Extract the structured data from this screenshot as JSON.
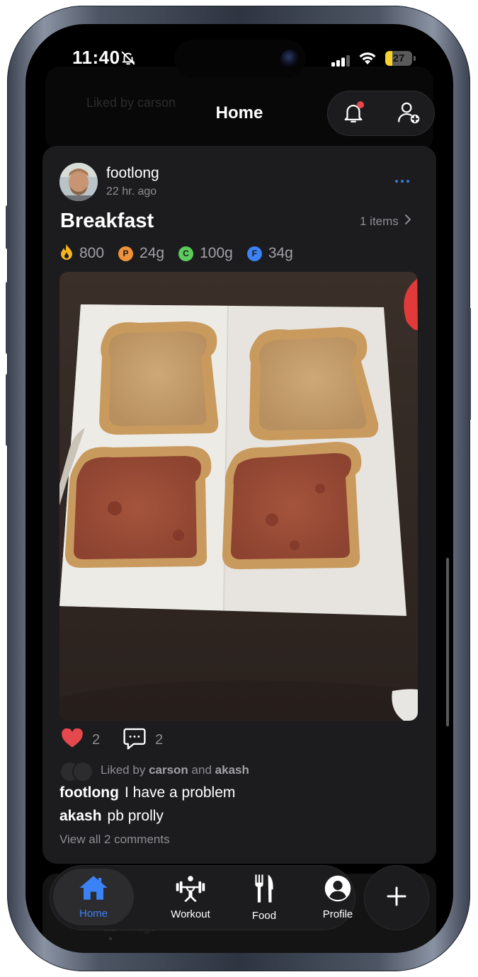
{
  "status_bar": {
    "time": "11:40",
    "battery_level": "27",
    "battery_fraction": 0.27
  },
  "header": {
    "title": "Home"
  },
  "background_ghost": {
    "text": "Liked by carson",
    "time": "22 hr. ago"
  },
  "post": {
    "username": "footlong",
    "time_ago": "22 hr. ago",
    "meal_title": "Breakfast",
    "items_label": "1 items",
    "macros": {
      "calories": "800",
      "protein_badge": "P",
      "protein": "24g",
      "carbs_badge": "C",
      "carbs": "100g",
      "fat_badge": "F",
      "fat": "34g"
    },
    "likes_count": "2",
    "comments_count": "2",
    "liked_by": {
      "prefix": "Liked by",
      "user1": "carson",
      "joiner": "and",
      "user2": "akash"
    },
    "comments": [
      {
        "user": "footlong",
        "text": "I have a problem"
      },
      {
        "user": "akash",
        "text": "pb prolly"
      }
    ],
    "view_all_label": "View all 2 comments"
  },
  "tabbar": {
    "tabs": [
      {
        "label": "Home",
        "icon": "home-icon",
        "active": true
      },
      {
        "label": "Workout",
        "icon": "weightlifter-icon",
        "active": false
      },
      {
        "label": "Food",
        "icon": "fork-knife-icon",
        "active": false
      },
      {
        "label": "Profile",
        "icon": "profile-icon",
        "active": false
      }
    ]
  },
  "colors": {
    "accent": "#3b82f6",
    "protein": "#f0923a",
    "carbs": "#5ccc5c",
    "fat": "#3b82f6",
    "calories": "#f5b520",
    "like": "#e5484d",
    "notification_dot": "#e5484d",
    "battery": "#f5d02e"
  }
}
